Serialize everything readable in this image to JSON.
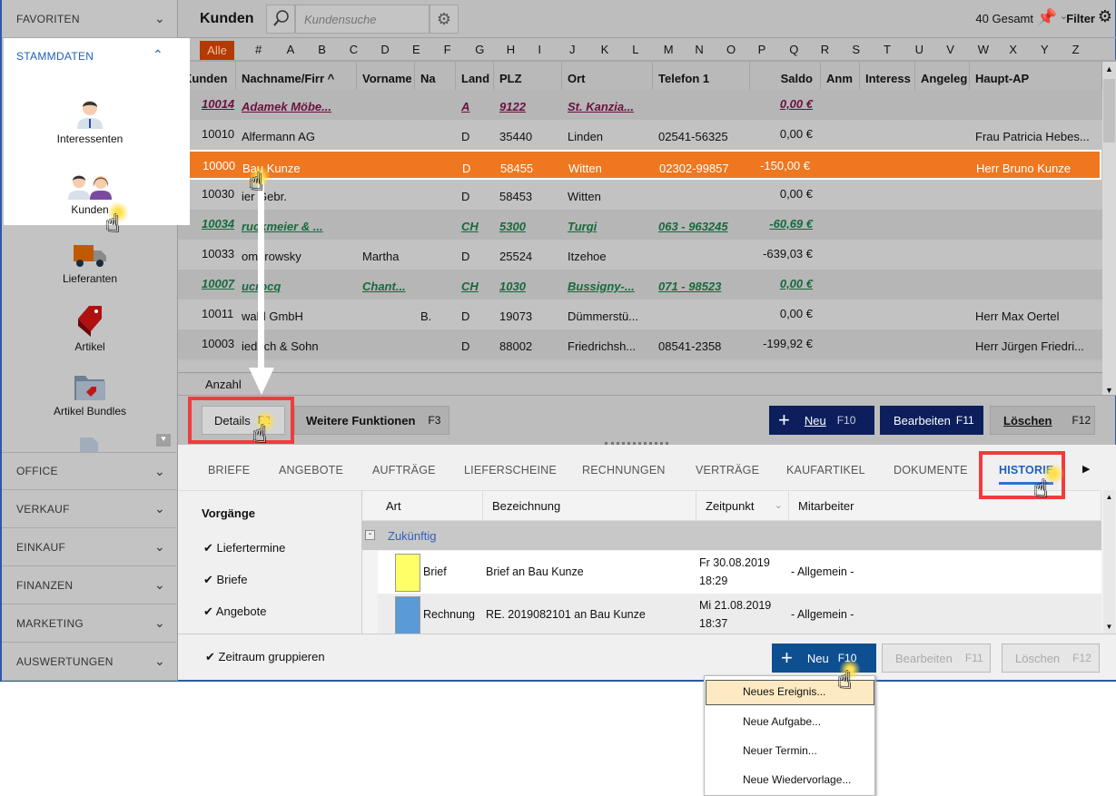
{
  "sidebar": {
    "sections_top": [
      {
        "label": "FAVORITEN"
      }
    ],
    "stammdaten": {
      "label": "STAMMDATEN",
      "items": [
        {
          "label": "Interessenten",
          "icon": "person-icon"
        },
        {
          "label": "Kunden",
          "icon": "people-icon"
        }
      ]
    },
    "items": [
      {
        "label": "Lieferanten",
        "icon": "truck-icon"
      },
      {
        "label": "Artikel",
        "icon": "tag-icon"
      },
      {
        "label": "Artikel Bundles",
        "icon": "folder-tag-icon"
      }
    ],
    "sections": [
      {
        "label": "OFFICE"
      },
      {
        "label": "VERKAUF"
      },
      {
        "label": "EINKAUF"
      },
      {
        "label": "FINANZEN"
      },
      {
        "label": "MARKETING"
      },
      {
        "label": "AUSWERTUNGEN"
      }
    ]
  },
  "header": {
    "title": "Kunden",
    "search_placeholder": "Kundensuche",
    "total": "40 Gesamt",
    "filter": "Filter"
  },
  "alphabet": [
    "Alle",
    "#",
    "A",
    "B",
    "C",
    "D",
    "E",
    "F",
    "G",
    "H",
    "I",
    "J",
    "K",
    "L",
    "M",
    "N",
    "O",
    "P",
    "Q",
    "R",
    "S",
    "T",
    "U",
    "V",
    "W",
    "X",
    "Y",
    "Z"
  ],
  "columns": [
    "Kunden",
    "Nachname/Firr",
    "Vorname",
    "Na",
    "Land",
    "PLZ",
    "Ort",
    "Telefon 1",
    "Saldo",
    "Anm",
    "Interess",
    "Angeleg",
    "Haupt-AP"
  ],
  "rows": [
    {
      "nr": "10014",
      "name": "Adamek Möbe...",
      "vorname": "",
      "na": "",
      "land": "A",
      "plz": "9122",
      "ort": "St. Kanzia...",
      "tel": "",
      "saldo": "0,00 €",
      "ap": "",
      "style": "purple"
    },
    {
      "nr": "10010",
      "name": "Alfermann AG",
      "vorname": "",
      "na": "",
      "land": "D",
      "plz": "35440",
      "ort": "Linden",
      "tel": "02541-56325",
      "saldo": "0,00 €",
      "ap": "Frau Patricia Hebes...",
      "style": "normal"
    },
    {
      "nr": "10000",
      "name": "Bau Kunze",
      "vorname": "",
      "na": "",
      "land": "D",
      "plz": "58455",
      "ort": "Witten",
      "tel": "02302-99857",
      "saldo": "-150,00 €",
      "ap": "Herr Bruno Kunze",
      "style": "selected"
    },
    {
      "nr": "10030",
      "name": "ier Gebr.",
      "vorname": "",
      "na": "",
      "land": "D",
      "plz": "58453",
      "ort": "Witten",
      "tel": "",
      "saldo": "0,00 €",
      "ap": "",
      "style": "normal"
    },
    {
      "nr": "10034",
      "name": "ruckmeier & ...",
      "vorname": "",
      "na": "",
      "land": "CH",
      "plz": "5300",
      "ort": "Turgi",
      "tel": "063 - 963245",
      "saldo": "-60,69 €",
      "ap": "",
      "style": "green"
    },
    {
      "nr": "10033",
      "name": "ombrowsky",
      "vorname": "Martha",
      "na": "",
      "land": "D",
      "plz": "25524",
      "ort": "Itzehoe",
      "tel": "",
      "saldo": "-639,03 €",
      "ap": "",
      "style": "normal"
    },
    {
      "nr": "10007",
      "name": "ucrocq",
      "vorname": "Chant...",
      "na": "",
      "land": "CH",
      "plz": "1030",
      "ort": "Bussigny-...",
      "tel": "071 - 98523",
      "saldo": "0,00 €",
      "ap": "",
      "style": "green"
    },
    {
      "nr": "10011",
      "name": "wald GmbH",
      "vorname": "",
      "na": "B.",
      "land": "D",
      "plz": "19073",
      "ort": "Dümmerstü...",
      "tel": "",
      "saldo": "0,00 €",
      "ap": "Herr Max Oertel",
      "style": "normal"
    },
    {
      "nr": "10003",
      "name": "iedrich & Sohn",
      "vorname": "",
      "na": "",
      "land": "D",
      "plz": "88002",
      "ort": "Friedrichsh...",
      "tel": "08541-2358",
      "saldo": "-199,92 €",
      "ap": "Herr Jürgen Friedri...",
      "style": "normal"
    }
  ],
  "footer_label": "Anzahl",
  "toolbar": {
    "details": "Details",
    "details_key": "F2",
    "weitere": "Weitere Funktionen",
    "weitere_key": "F3",
    "neu": "Neu",
    "neu_key": "F10",
    "bearbeiten": "Bearbeiten",
    "bearbeiten_key": "F11",
    "loeschen": "Löschen",
    "loeschen_key": "F12"
  },
  "tabs": [
    "BRIEFE",
    "ANGEBOTE",
    "AUFTRÄGE",
    "LIEFERSCHEINE",
    "RECHNUNGEN",
    "VERTRÄGE",
    "KAUFARTIKEL",
    "DOKUMENTE",
    "HISTORIE"
  ],
  "active_tab": "HISTORIE",
  "vorgaenge": {
    "title": "Vorgänge",
    "items": [
      {
        "label": "Liefertermine",
        "checked": true
      },
      {
        "label": "Briefe",
        "checked": true
      },
      {
        "label": "Angebote",
        "checked": true
      }
    ]
  },
  "history": {
    "columns": [
      "Art",
      "Bezeichnung",
      "Zeitpunkt",
      "Mitarbeiter"
    ],
    "group": "Zukünftig",
    "rows": [
      {
        "art": "Brief",
        "color": "#ffff66",
        "bez": "Brief an Bau Kunze",
        "date": "Fr 30.08.2019",
        "time": "18:29",
        "mit": "- Allgemein -"
      },
      {
        "art": "Rechnung",
        "color": "#5b9bd5",
        "bez": "RE. 2019082101 an Bau Kunze",
        "date": "Mi 21.08.2019",
        "time": "18:37",
        "mit": "- Allgemein -"
      }
    ]
  },
  "detail_footer": {
    "zeitraum": "Zeitraum gruppieren",
    "neu": "Neu",
    "neu_key": "F10",
    "bearbeiten": "Bearbeiten",
    "bearbeiten_key": "F11",
    "loeschen": "Löschen",
    "loeschen_key": "F12"
  },
  "menu": [
    "Neues Ereignis...",
    "Neue Aufgabe...",
    "Neuer Termin...",
    "Neue Wiedervorlage..."
  ],
  "colors": {
    "selected": "#ee7720",
    "purple": "#6b1040",
    "green": "#17693c",
    "alle": "#b33a00",
    "dark_button": "#0c1f5c",
    "blue_button": "#0d4f91"
  }
}
